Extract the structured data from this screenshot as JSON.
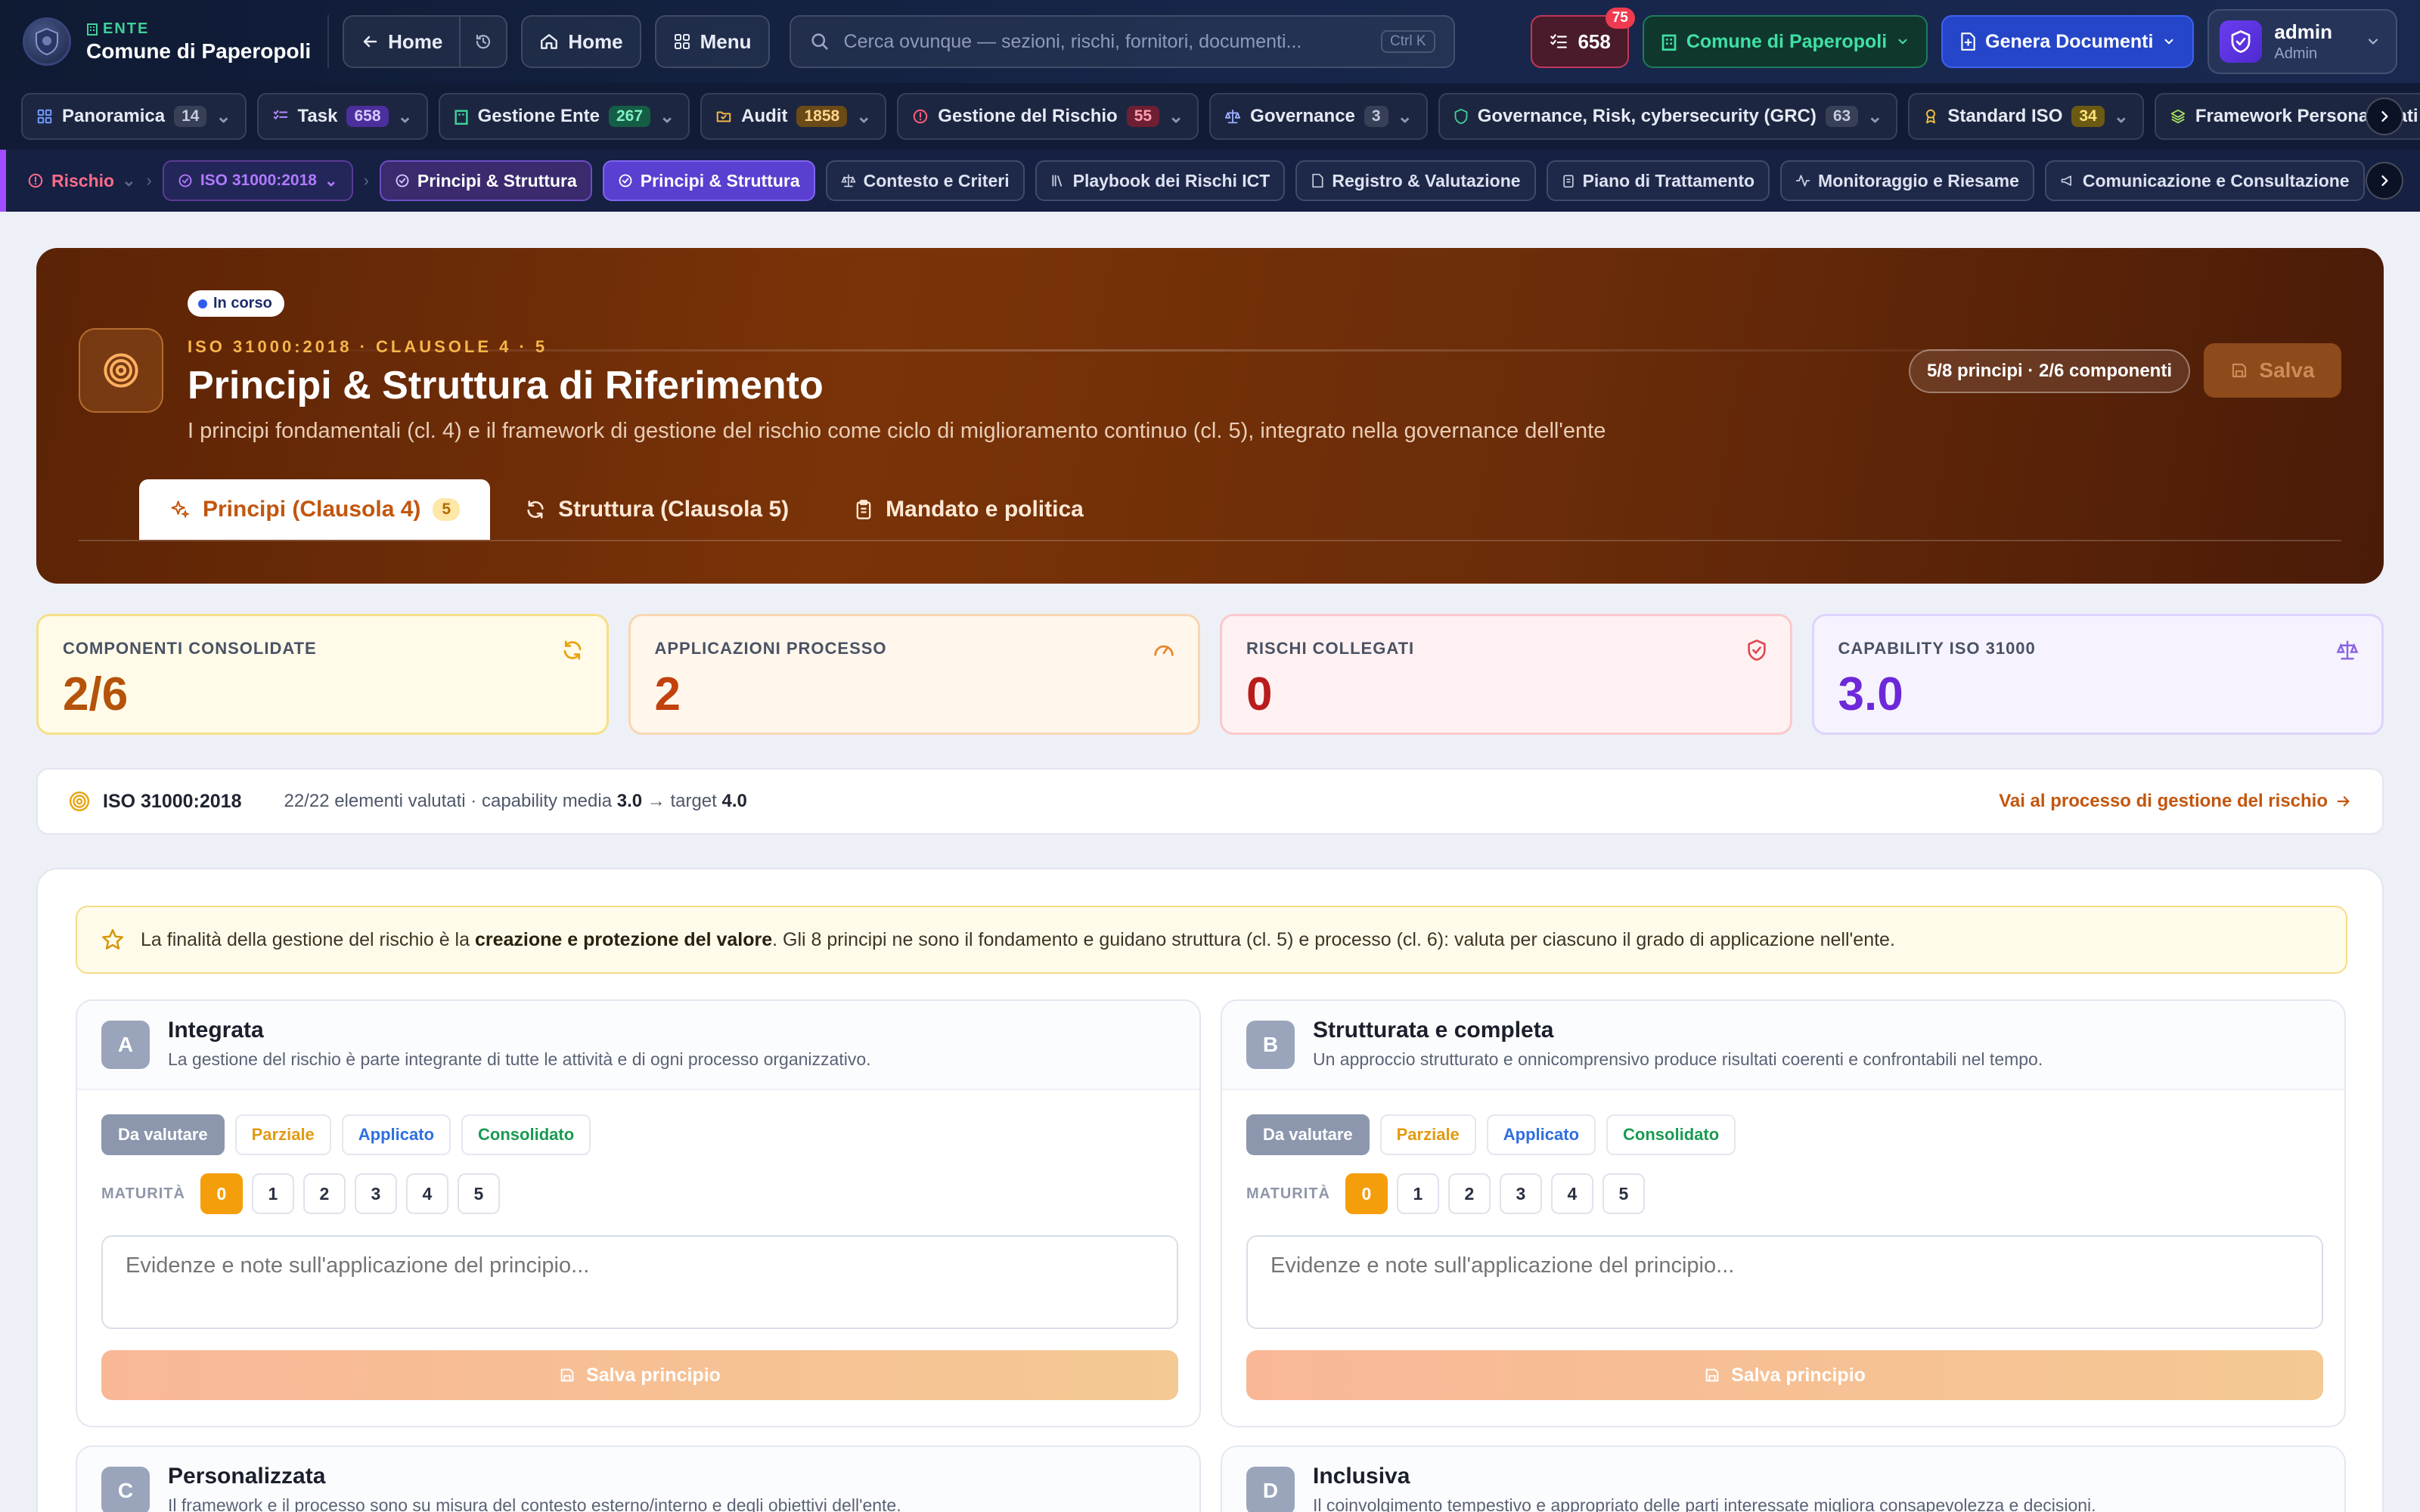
{
  "topbar": {
    "brand_kicker": "ENTE",
    "brand_name": "Comune di Paperopoli",
    "back_label": "Home",
    "home_label": "Home",
    "menu_label": "Menu",
    "search_placeholder": "Cerca ovunque — sezioni, rischi, fornitori, documenti...",
    "search_shortcut": "Ctrl K",
    "tasks_count": "658",
    "tasks_badge": "75",
    "ente_label": "Comune di Paperopoli",
    "generate_label": "Genera Documenti",
    "user_name": "admin",
    "user_role": "Admin"
  },
  "modules": [
    {
      "label": "Panoramica",
      "count": "14"
    },
    {
      "label": "Task",
      "count": "658"
    },
    {
      "label": "Gestione Ente",
      "count": "267"
    },
    {
      "label": "Audit",
      "count": "1858"
    },
    {
      "label": "Gestione del Rischio",
      "count": "55"
    },
    {
      "label": "Governance",
      "count": "3"
    },
    {
      "label": "Governance, Risk, cybersecurity (GRC)",
      "count": "63"
    },
    {
      "label": "Standard ISO",
      "count": "34"
    },
    {
      "label": "Framework Personalizzati",
      "count": ""
    }
  ],
  "subnav": {
    "crumb": "Rischio",
    "iso_pill": "ISO 31000:2018",
    "current_pill": "Principi & Struttura",
    "tabs": [
      "Principi & Struttura",
      "Contesto e Criteri",
      "Playbook dei Rischi ICT",
      "Registro & Valutazione",
      "Piano di Trattamento",
      "Monitoraggio e Riesame",
      "Comunicazione e Consultazione"
    ]
  },
  "hero": {
    "status": "In corso",
    "kicker": "ISO 31000:2018 · CLAUSOLE 4 · 5",
    "title": "Principi & Struttura di Riferimento",
    "subtitle": "I principi fondamentali (cl. 4) e il framework di gestione del rischio come ciclo di miglioramento continuo (cl. 5), integrato nella governance dell'ente",
    "progress": "5/8 principi · 2/6 componenti",
    "save_label": "Salva",
    "tabs": [
      {
        "label": "Principi (Clausola 4)",
        "count": "5"
      },
      {
        "label": "Struttura (Clausola 5)",
        "count": ""
      },
      {
        "label": "Mandato e politica",
        "count": ""
      }
    ]
  },
  "stats": [
    {
      "label": "COMPONENTI CONSOLIDATE",
      "value": "2/6"
    },
    {
      "label": "APPLICAZIONI PROCESSO",
      "value": "2"
    },
    {
      "label": "RISCHI COLLEGATI",
      "value": "0"
    },
    {
      "label": "CAPABILITY ISO 31000",
      "value": "3.0"
    }
  ],
  "iso_strip": {
    "name": "ISO 31000:2018",
    "evaluated": "22/22 elementi valutati · capability media",
    "capability": "3.0",
    "arrow": "→ target",
    "target": "4.0",
    "link": "Vai al processo di gestione del rischio"
  },
  "intro": {
    "before": "La finalità della gestione del rischio è la ",
    "bold": "creazione e protezione del valore",
    "after": ". Gli 8 principi ne sono il fondamento e guidano struttura (cl. 5) e processo (cl. 6): valuta per ciascuno il grado di applicazione nell'ente."
  },
  "status_options": [
    "Da valutare",
    "Parziale",
    "Applicato",
    "Consolidato"
  ],
  "maturity_label": "MATURITÀ",
  "maturity_levels": [
    "0",
    "1",
    "2",
    "3",
    "4",
    "5"
  ],
  "notes_placeholder": "Evidenze e note sull'applicazione del principio...",
  "save_principle_label": "Salva principio",
  "principles": [
    {
      "letter": "A",
      "name": "Integrata",
      "desc": "La gestione del rischio è parte integrante di tutte le attività e di ogni processo organizzativo.",
      "status": "Da valutare",
      "maturity": "0"
    },
    {
      "letter": "B",
      "name": "Strutturata e completa",
      "desc": "Un approccio strutturato e onnicomprensivo produce risultati coerenti e confrontabili nel tempo.",
      "status": "Da valutare",
      "maturity": "0"
    },
    {
      "letter": "C",
      "name": "Personalizzata",
      "desc": "Il framework e il processo sono su misura del contesto esterno/interno e degli obiettivi dell'ente."
    },
    {
      "letter": "D",
      "name": "Inclusiva",
      "desc": "Il coinvolgimento tempestivo e appropriato delle parti interessate migliora consapevolezza e decisioni."
    }
  ],
  "colors": {
    "accent": "#c2560e",
    "hero_bg": "#7a3308",
    "maturity_selected": "#f59e0b",
    "subnav_accent": "#a24dff"
  }
}
